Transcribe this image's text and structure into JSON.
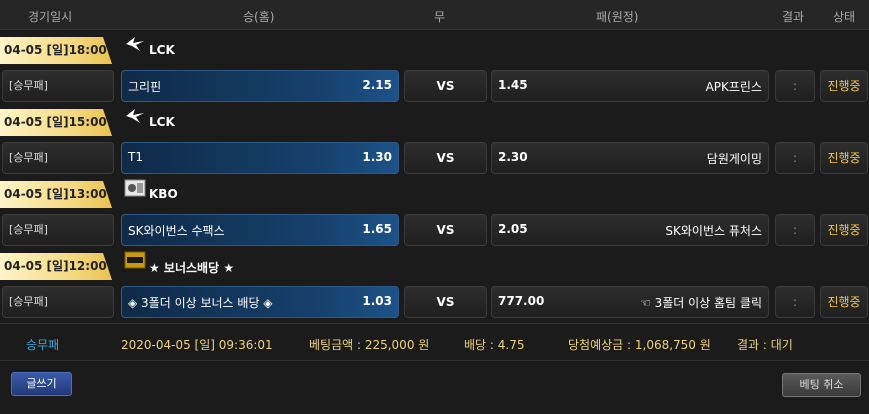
{
  "header": {
    "date": "경기일시",
    "home": "승(홈)",
    "draw": "무",
    "away": "패(원정)",
    "result": "결과",
    "status": "상태"
  },
  "groups": [
    {
      "date": "04-05 [일]18:00",
      "league": "LCK",
      "league_icon": "lck-icon",
      "match": {
        "type": "[승무패]",
        "home": "그리핀",
        "home_odd": "2.15",
        "vs": "VS",
        "away_odd": "1.45",
        "away": "APK프린스",
        "result": ":",
        "status": "진행중"
      }
    },
    {
      "date": "04-05 [일]15:00",
      "league": "LCK",
      "league_icon": "lck-icon",
      "match": {
        "type": "[승무패]",
        "home": "T1",
        "home_odd": "1.30",
        "vs": "VS",
        "away_odd": "2.30",
        "away": "담원게이밍",
        "result": ":",
        "status": "진행중"
      }
    },
    {
      "date": "04-05 [일]13:00",
      "league": "KBO",
      "league_icon": "kbo-icon",
      "match": {
        "type": "[승무패]",
        "home": "SK와이번스 수팩스",
        "home_odd": "1.65",
        "vs": "VS",
        "away_odd": "2.05",
        "away": "SK와이번스 퓨처스",
        "result": ":",
        "status": "진행중"
      }
    },
    {
      "date": "04-05 [일]12:00",
      "league": "★ 보너스배당 ★",
      "league_icon": "bonus-icon",
      "match": {
        "type": "[승무패]",
        "home": "◈ 3폴더 이상 보너스 배당 ◈",
        "home_odd": "1.03",
        "vs": "VS",
        "away_odd": "777.00",
        "away": "☜ 3폴더 이상 홈팀 클릭",
        "result": ":",
        "status": "진행중"
      }
    }
  ],
  "summary": {
    "type": "승무패",
    "datetime": "2020-04-05 [일] 09:36:01",
    "bet_amount": "베팅금액 : 225,000 원",
    "odds": "배당 : 4.75",
    "expected": "당첨예상금 : 1,068,750 원",
    "result": "결과 : 대기"
  },
  "buttons": {
    "write": "글쓰기",
    "cancel": "베팅 취소"
  },
  "colors": {
    "accent_gold": "#f2c44b",
    "home_blue": "#16406c",
    "summary_type": "#3aa7e0"
  }
}
